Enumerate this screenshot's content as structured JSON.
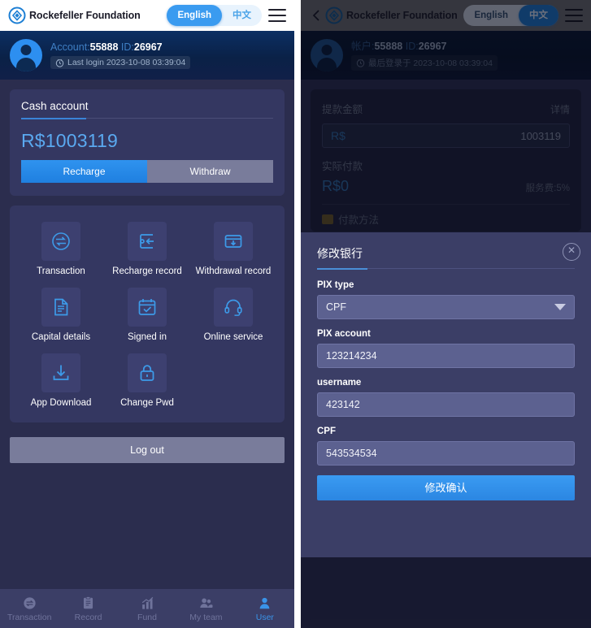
{
  "left": {
    "header": {
      "brand": "Rockefeller Foundation",
      "logo_icon": "diamond-logo-icon",
      "lang_en": "English",
      "lang_zh": "中文",
      "active_lang": "English",
      "menu_icon": "hamburger-menu-icon"
    },
    "account": {
      "avatar_icon": "user-avatar-icon",
      "account_label": "Account:",
      "account_value": "55888",
      "id_label": "ID:",
      "id_value": "26967",
      "clock_icon": "clock-icon",
      "last_login": "Last login 2023-10-08 03:39:04"
    },
    "cash_card": {
      "title": "Cash account",
      "balance": "R$1003119",
      "recharge_label": "Recharge",
      "withdraw_label": "Withdraw"
    },
    "grid": [
      {
        "label": "Transaction",
        "icon": "transfer-arrows-icon"
      },
      {
        "label": "Recharge record",
        "icon": "recharge-record-icon"
      },
      {
        "label": "Withdrawal record",
        "icon": "card-download-icon"
      },
      {
        "label": "Capital details",
        "icon": "document-lines-icon"
      },
      {
        "label": "Signed in",
        "icon": "calendar-check-icon"
      },
      {
        "label": "Online service",
        "icon": "headset-icon"
      },
      {
        "label": "App Download",
        "icon": "download-tray-icon"
      },
      {
        "label": "Change Pwd",
        "icon": "lock-icon"
      }
    ],
    "logout_label": "Log out",
    "bottom_nav": [
      {
        "label": "Transaction",
        "icon": "transfer-arrows-icon",
        "active": false
      },
      {
        "label": "Record",
        "icon": "clipboard-icon",
        "active": false
      },
      {
        "label": "Fund",
        "icon": "bar-chart-icon",
        "active": false
      },
      {
        "label": "My team",
        "icon": "people-icon",
        "active": false
      },
      {
        "label": "User",
        "icon": "person-icon",
        "active": true
      }
    ]
  },
  "right": {
    "header": {
      "back_icon": "back-chevron-icon",
      "brand": "Rockefeller Foundation",
      "logo_icon": "diamond-logo-icon",
      "lang_en": "English",
      "lang_zh": "中文",
      "active_lang": "中文",
      "menu_icon": "hamburger-menu-icon"
    },
    "account": {
      "avatar_icon": "user-avatar-icon",
      "account_label": "帐户:",
      "account_value": "55888",
      "id_label": "ID:",
      "id_value": "26967",
      "clock_icon": "clock-icon",
      "last_login": "最后登录于 2023-10-08 03:39:04"
    },
    "withdraw": {
      "amount_label": "提款金额",
      "detail_link": "详情",
      "currency_prefix": "R$",
      "balance_hint": "1003119",
      "actual_label": "实际付款",
      "actual_value": "R$0",
      "fee_note": "服务费:5%",
      "pay_method_label": "付款方法",
      "pay_method_icon": "card-icon"
    },
    "modal": {
      "title": "修改银行",
      "close_icon": "close-circle-icon",
      "fields": [
        {
          "label": "PIX type",
          "value": "CPF",
          "type": "select",
          "name": "pix-type-select"
        },
        {
          "label": "PIX account",
          "value": "123214234",
          "type": "text",
          "name": "pix-account-input"
        },
        {
          "label": "username",
          "value": "423142",
          "type": "text",
          "name": "username-input"
        },
        {
          "label": "CPF",
          "value": "543534534",
          "type": "text",
          "name": "cpf-input"
        }
      ],
      "submit_label": "修改确认",
      "caret_icon": "chevron-down-icon"
    }
  },
  "colors": {
    "accent_blue": "#3a93e8",
    "panel_bg": "#2b2d4e",
    "card_bg": "#343761",
    "modal_bg": "#3b3e66",
    "muted_button": "#797c9b"
  }
}
